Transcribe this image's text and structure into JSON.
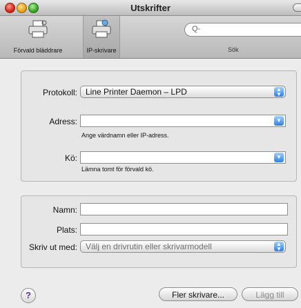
{
  "window": {
    "title": "Utskrifter"
  },
  "toolbar": {
    "default_browser_label": "Förvald bläddrare",
    "ip_printer_label": "IP-skrivare",
    "search_placeholder": "Q-",
    "search_label": "Sök"
  },
  "protocol": {
    "label": "Protokoll:",
    "value": "Line Printer Daemon – LPD"
  },
  "address": {
    "label": "Adress:",
    "value": "",
    "hint": "Ange värdnamn eller IP-adress."
  },
  "queue": {
    "label": "Kö:",
    "value": "",
    "hint": "Lämna tomt för förvald kö."
  },
  "name": {
    "label": "Namn:",
    "value": ""
  },
  "location": {
    "label": "Plats:",
    "value": ""
  },
  "print_with": {
    "label": "Skriv ut med:",
    "value": "Välj en drivrutin eller skrivarmodell"
  },
  "buttons": {
    "help": "?",
    "more_printers": "Fler skrivare...",
    "add": "Lägg till"
  },
  "icons": {
    "default_browser": "printer-icon",
    "ip_printer": "network-printer-icon",
    "search": "magnifier-icon"
  }
}
